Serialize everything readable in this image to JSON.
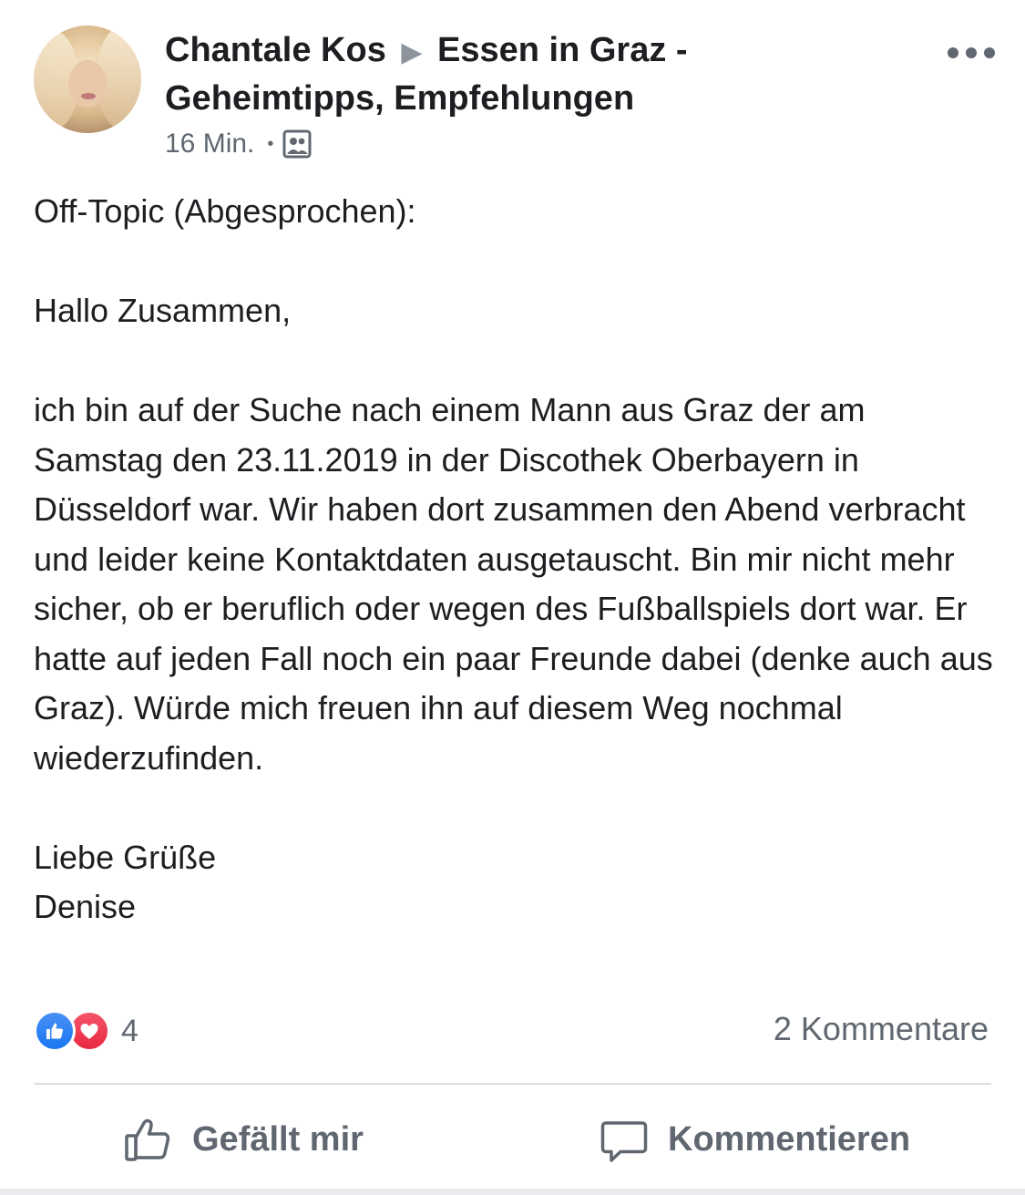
{
  "post": {
    "author": "Chantale Kos",
    "group": "Essen in Graz -",
    "group_line2": "Geheimtipps, Empfehlungen",
    "time": "16 Min.",
    "paragraphs": [
      "Off-Topic (Abgesprochen):",
      "Hallo Zusammen,",
      "ich bin auf der Suche nach einem Mann aus Graz der am Samstag den 23.11.2019 in der Discothek Oberbayern in Düsseldorf war. Wir haben dort zusammen den Abend verbracht und leider keine Kontaktdaten ausgetauscht. Bin mir nicht mehr sicher, ob er beruflich oder wegen des Fußballspiels dort war. Er hatte auf jeden Fall noch ein paar Freunde dabei (denke auch aus Graz). Würde mich freuen ihn auf diesem Weg nochmal wiederzufinden.",
      "Liebe Grüße",
      "Denise"
    ],
    "reaction_count": "4",
    "comment_count": "2 Kommentare"
  },
  "actions": {
    "like_label": "Gefällt mir",
    "comment_label": "Kommentieren"
  },
  "icons": {
    "privacy": "group-icon",
    "more": "more-options-icon",
    "like_reaction": "like-reaction-icon",
    "love_reaction": "love-reaction-icon",
    "like_action": "thumbs-up-icon",
    "comment_action": "comment-bubble-icon"
  },
  "colors": {
    "like_blue": "#1877f2",
    "love_red": "#e8283f",
    "secondary_text": "#606770"
  }
}
